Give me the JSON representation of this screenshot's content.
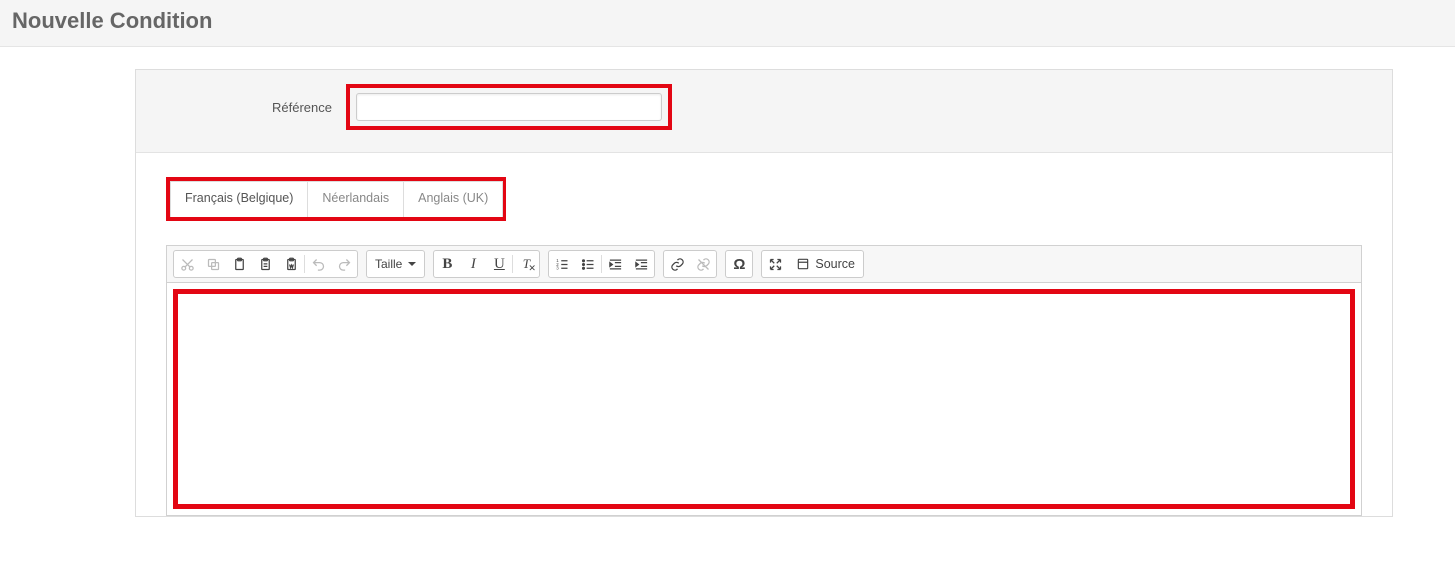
{
  "header": {
    "title": "Nouvelle Condition"
  },
  "form": {
    "reference_label": "Référence",
    "reference_value": ""
  },
  "tabs": [
    {
      "label": "Français (Belgique)",
      "active": true
    },
    {
      "label": "Néerlandais",
      "active": false
    },
    {
      "label": "Anglais (UK)",
      "active": false
    }
  ],
  "toolbar": {
    "size_label": "Taille",
    "source_label": "Source"
  },
  "highlight_color": "#e30613"
}
